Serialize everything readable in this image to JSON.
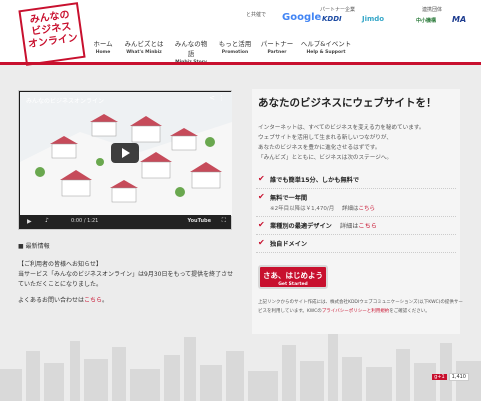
{
  "logo": {
    "lines": [
      "みんなの",
      "ビジネス",
      "オンライン"
    ]
  },
  "header": {
    "partners_label": "と共催で",
    "partner_label": "パートナー企業",
    "support_label": "連携団体",
    "partner_logos": [
      "Google",
      "KDDI",
      "Jimdo",
      "中小機構",
      "MA"
    ]
  },
  "nav": [
    {
      "jp": "ホーム",
      "en": "Home",
      "active": true
    },
    {
      "jp": "みんビズとは",
      "en": "What's Minbiz"
    },
    {
      "jp": "みんなの物語",
      "en": "Minbiz Story"
    },
    {
      "jp": "もっと活用",
      "en": "Promotion"
    },
    {
      "jp": "パートナー",
      "en": "Partner"
    },
    {
      "jp": "ヘルプ&イベント",
      "en": "Help & Support"
    }
  ],
  "video": {
    "title": "みんなのビジネスオンライン",
    "time": "0:00 / 1:21",
    "brand": "YouTube"
  },
  "news": {
    "heading": "■ 最新情報",
    "notice_title": "【ご利用者の皆様へお知らせ】",
    "body": "当サービス「みんなのビジネスオンライン」は9月30日をもって提供を終了させていただくことになりました。",
    "contact_prefix": "よくあるお問い合わせは",
    "contact_link": "こちら",
    "contact_suffix": "。"
  },
  "panel": {
    "heading": "あなたのビジネスにウェブサイトを！",
    "intro_lines": [
      "インターネットは、すべてのビジネスを変える力を秘めています。",
      "ウェブサイトを活用して生まれる新しいつながりが、",
      "あなたのビジネスを豊かに進化させるはずです。",
      "「みんビズ」とともに、ビジネスは次のステージへ。"
    ],
    "features": [
      {
        "text": "誰でも簡単15分、しかも無料で"
      },
      {
        "text": "無料で一年間",
        "sub": "※2年目以降は￥1,470/月",
        "detail": "詳細は",
        "link": "こちら"
      },
      {
        "text": "業種別の最適デザイン",
        "detail": "詳細は",
        "link": "こちら"
      },
      {
        "text": "独自ドメイン"
      }
    ],
    "cta_jp": "さあ、はじめよう",
    "cta_en": "Get Started",
    "notice_text": "上記リンクからのサイト作成には、株式会社KDDIウェブコミュニケーションズ(以下KWC)の提供サービスを利用しています。KWCの",
    "notice_link": "プライバシーポリシーと利用規約",
    "notice_suffix": "をご確認ください。"
  },
  "social": {
    "label": "g+1",
    "count": "1,410"
  }
}
